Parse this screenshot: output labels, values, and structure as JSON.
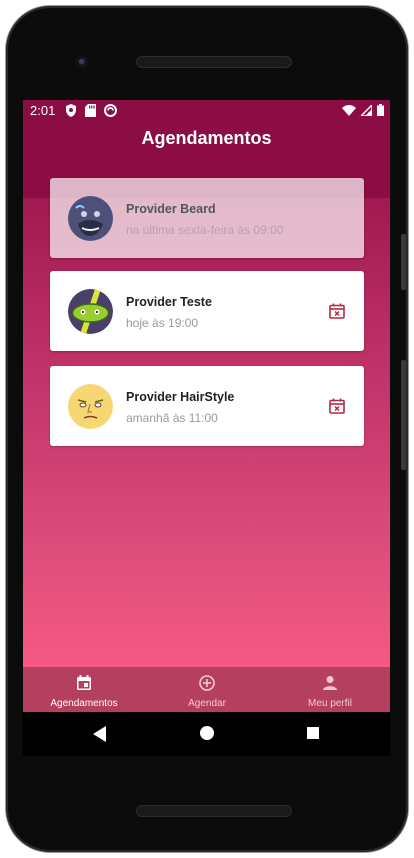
{
  "status_bar": {
    "time": "2:01"
  },
  "header": {
    "title": "Agendamentos"
  },
  "appointments": [
    {
      "provider": "Provider Beard",
      "time": "na última sexta-feira às 09:00",
      "past": true
    },
    {
      "provider": "Provider Teste",
      "time": "hoje às 19:00",
      "past": false
    },
    {
      "provider": "Provider HairStyle",
      "time": "amanhã às 11:00",
      "past": false
    }
  ],
  "bottom_nav": [
    {
      "label": "Agendamentos",
      "icon": "calendar-icon",
      "active": true
    },
    {
      "label": "Agendar",
      "icon": "add-circle-icon",
      "active": false
    },
    {
      "label": "Meu perfil",
      "icon": "person-icon",
      "active": false
    }
  ],
  "colors": {
    "primary": "#8b0d43",
    "gradient_bottom": "#ff5d86",
    "nav_background": "#b53f5f",
    "cancel_icon": "#b22a4a"
  }
}
